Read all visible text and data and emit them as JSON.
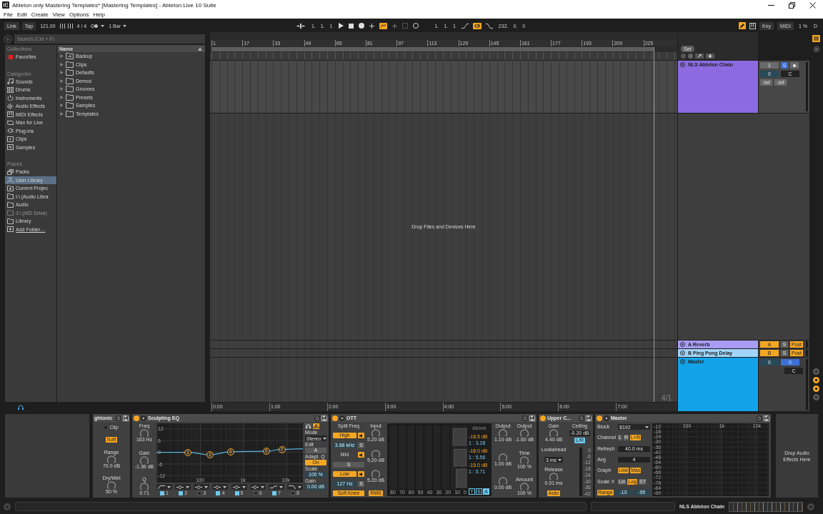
{
  "window": {
    "title": "Ableton only Mastering Templates* [Mastering Templates] - Ableton Live 10 Suite"
  },
  "menu": [
    "File",
    "Edit",
    "Create",
    "View",
    "Options",
    "Help"
  ],
  "transport": {
    "link": "Link",
    "tap": "Tap",
    "tempo": "121.00",
    "signature": "4 / 4",
    "quantization": "1 Bar",
    "position": "1. 1. 1",
    "automation_arm": true,
    "loop_start": "1. 1. 1",
    "loop": true,
    "loop_length": "232. 0. 0",
    "draw_mode": true,
    "key": "Key",
    "midi": "MIDI",
    "cpu": "1 %",
    "disk": "D"
  },
  "browser": {
    "search": {
      "placeholder": "Search (Ctrl + F)"
    },
    "sections": [
      {
        "heading": "Collections",
        "items": [
          {
            "label": "Favorites",
            "kind": "swatch",
            "color": "#e8201c",
            "selected": false,
            "disabled": false
          }
        ]
      },
      {
        "heading": "Categories",
        "items": [
          {
            "label": "Sounds",
            "kind": "note",
            "selected": false,
            "disabled": false
          },
          {
            "label": "Drums",
            "kind": "pads",
            "selected": false,
            "disabled": false
          },
          {
            "label": "Instruments",
            "kind": "power",
            "selected": false,
            "disabled": false
          },
          {
            "label": "Audio Effects",
            "kind": "wave",
            "selected": false,
            "disabled": false
          },
          {
            "label": "MIDI Effects",
            "kind": "midi",
            "selected": false,
            "disabled": false
          },
          {
            "label": "Max for Live",
            "kind": "loop",
            "selected": false,
            "disabled": false
          },
          {
            "label": "Plug-ins",
            "kind": "plug",
            "selected": false,
            "disabled": false
          },
          {
            "label": "Clips",
            "kind": "clip",
            "selected": false,
            "disabled": false
          },
          {
            "label": "Samples",
            "kind": "sample",
            "selected": false,
            "disabled": false
          }
        ]
      },
      {
        "heading": "Places",
        "items": [
          {
            "label": "Packs",
            "kind": "packs",
            "selected": false,
            "disabled": false
          },
          {
            "label": "User Library",
            "kind": "user",
            "selected": true,
            "disabled": false
          },
          {
            "label": "Current Projec",
            "kind": "project",
            "selected": false,
            "disabled": false
          },
          {
            "label": "I:\\ (Audio Libra",
            "kind": "folder",
            "selected": false,
            "disabled": false
          },
          {
            "label": "Audio",
            "kind": "folder",
            "selected": false,
            "disabled": false
          },
          {
            "label": "J:\\ (WD Drive)",
            "kind": "folder",
            "selected": false,
            "disabled": true
          },
          {
            "label": "Library",
            "kind": "folder",
            "selected": false,
            "disabled": false
          },
          {
            "label": "Add Folder…",
            "kind": "add",
            "selected": false,
            "disabled": false
          }
        ]
      }
    ],
    "column": "Name",
    "items": [
      {
        "label": "Backup",
        "kind": "backup",
        "expanded": false
      },
      {
        "label": "Clips",
        "kind": "folder",
        "expanded": false
      },
      {
        "label": "Defaults",
        "kind": "folder",
        "expanded": false
      },
      {
        "label": "Demos",
        "kind": "folder",
        "expanded": false
      },
      {
        "label": "Grooves",
        "kind": "folder",
        "expanded": false
      },
      {
        "label": "Presets",
        "kind": "folder",
        "expanded": false
      },
      {
        "label": "Samples",
        "kind": "folder",
        "expanded": false
      },
      {
        "label": "Templates",
        "kind": "folder",
        "expanded": false
      }
    ]
  },
  "arrangement": {
    "bars": [
      "1",
      "17",
      "33",
      "49",
      "65",
      "81",
      "97",
      "113",
      "129",
      "145",
      "161",
      "177",
      "193",
      "209",
      "225"
    ],
    "set": "Set",
    "tracks": [
      {
        "kind": "audio",
        "name": "NLS Ableton Chain",
        "color": "#8c6be0",
        "expanded": true,
        "activator": "1",
        "solo": "S",
        "solo_on": true,
        "volume": "0",
        "pan": "C",
        "meters": [
          "-inf",
          "-inf"
        ]
      },
      {
        "kind": "return",
        "name": "A Reverb",
        "color": "#a89cf5",
        "expanded": false,
        "send": "A",
        "solo": "S",
        "solo_on": false,
        "route": "Post"
      },
      {
        "kind": "return",
        "name": "B Ping Pong Delay",
        "color": "#a2d5f9",
        "expanded": false,
        "send": "B",
        "solo": "S",
        "solo_on": false,
        "route": "Post"
      },
      {
        "kind": "master",
        "name": "Master",
        "color": "#12a2e8",
        "expanded": true,
        "volume": "0",
        "cue": "0",
        "pan": "C"
      }
    ],
    "drop_hint": "Drop Files and Devices Here",
    "zoom": "4/1",
    "times": [
      "0:00",
      "1:00",
      "2:00",
      "3:00",
      "4:00",
      "5:00",
      "6:00",
      "7:00"
    ]
  },
  "view_toggles": [
    {
      "on": false
    },
    {
      "on": true
    },
    {
      "on": true
    },
    {
      "on": false
    }
  ],
  "devices": [
    {
      "kind": "partial",
      "name": "ghtonic",
      "columns": [
        [
          {
            "kind": "led",
            "text": "Clip",
            "on": false
          },
          {
            "kind": "toggle",
            "text": "Soft",
            "on": true
          },
          {
            "kind": "knob",
            "caption": "Range",
            "reading": "70.0 dB"
          },
          {
            "kind": "knob",
            "caption": "Dry/Wet",
            "reading": "50 %"
          }
        ]
      ]
    },
    {
      "kind": "eq",
      "name": "Sculpting EQ",
      "on": true,
      "expanded": false,
      "columns": [
        [
          {
            "kind": "knob",
            "caption": "Freq",
            "reading": "163 Hz"
          },
          {
            "kind": "knob",
            "caption": "Gain",
            "reading": "-1.36 dB"
          },
          {
            "kind": "knob",
            "caption": "Q",
            "reading": "0.71"
          }
        ],
        [
          {
            "kind": "eq_graph",
            "yticks": [
              "12",
              "6",
              "0",
              "-6",
              "-12"
            ],
            "xticks": [
              "100",
              "1k",
              "10k"
            ],
            "nodes": [
              "1",
              "2",
              "4",
              "5",
              "7"
            ]
          },
          {
            "kind": "bands",
            "items": [
              {
                "kind": "lowcut",
                "label": "1",
                "on": true
              },
              {
                "kind": "bell",
                "label": "2",
                "on": true
              },
              {
                "kind": "bell",
                "label": "3",
                "on": false
              },
              {
                "kind": "bell",
                "label": "4",
                "on": true
              },
              {
                "kind": "bell",
                "label": "5",
                "on": true
              },
              {
                "kind": "bell",
                "label": "6",
                "on": false
              },
              {
                "kind": "shelf",
                "label": "7",
                "on": true
              },
              {
                "kind": "highcut",
                "label": "8",
                "on": false
              }
            ]
          }
        ],
        [
          {
            "kind": "row",
            "items": [
              {
                "kind": "headphones_toggle",
                "on": false
              },
              {
                "kind": "spectrum_toggle",
                "on": true
              }
            ]
          },
          {
            "kind": "label",
            "text": "Mode"
          },
          {
            "kind": "dropdown",
            "text": "Stereo"
          },
          {
            "kind": "label",
            "text": "Edit"
          },
          {
            "kind": "toggle",
            "text": "A",
            "on": false
          },
          {
            "kind": "label",
            "text": "Adapt. Q"
          },
          {
            "kind": "toggle",
            "text": "On",
            "on": true
          },
          {
            "kind": "label",
            "text": "Scale"
          },
          {
            "kind": "number",
            "text": "100 %"
          },
          {
            "kind": "label",
            "text": "Gain"
          },
          {
            "kind": "number",
            "text": "0.00 dB"
          }
        ]
      ]
    },
    {
      "kind": "multiband",
      "name": "OTT",
      "on": true,
      "expanded": true,
      "columns": [
        [
          {
            "kind": "label",
            "text": "Split Freq"
          },
          {
            "kind": "row",
            "items": [
              {
                "kind": "toggle",
                "text": "High",
                "on": true
              },
              {
                "kind": "band_toggle",
                "on": true
              }
            ]
          },
          {
            "kind": "row",
            "items": [
              {
                "kind": "number",
                "text": "3.68 kHz"
              },
              {
                "kind": "toggle",
                "text": "S",
                "on": false
              }
            ]
          },
          {
            "kind": "row",
            "items": [
              {
                "kind": "label",
                "text": "Mid"
              },
              {
                "kind": "band_toggle",
                "on": true
              }
            ]
          },
          {
            "kind": "row",
            "items": [
              {
                "kind": "toggle",
                "text": "S",
                "on": false
              }
            ]
          },
          {
            "kind": "row",
            "items": [
              {
                "kind": "toggle",
                "text": "Low",
                "on": true
              },
              {
                "kind": "band_toggle",
                "on": true
              }
            ]
          },
          {
            "kind": "row",
            "items": [
              {
                "kind": "number",
                "text": "127 Hz"
              },
              {
                "kind": "toggle",
                "text": "S",
                "on": false
              }
            ]
          },
          {
            "kind": "toggle",
            "text": "Soft Knee",
            "on": true
          }
        ],
        [
          {
            "kind": "knob",
            "caption": "Input",
            "reading": "5.20 dB"
          },
          {
            "kind": "knob",
            "reading": "5.20 dB"
          },
          {
            "kind": "knob",
            "reading": "5.20 dB"
          },
          {
            "kind": "toggle",
            "text": "RMS",
            "on": true
          }
        ],
        [
          {
            "kind": "ott_display",
            "ticks": [
              "80",
              "70",
              "60",
              "50",
              "40",
              "30",
              "20",
              "10",
              "0"
            ],
            "heading": "Above",
            "bands": [
              {
                "threshold": "-18.5 dB",
                "ratio": "1 : 3.28"
              },
              {
                "threshold": "-18.0 dB",
                "ratio": "1 : 5.56"
              },
              {
                "threshold": "-15.0 dB",
                "ratio": "1 : 5.71"
              }
            ],
            "buttons": [
              {
                "text": "T",
                "on": false
              },
              {
                "text": "B",
                "on": false
              },
              {
                "text": "A",
                "on": true
              }
            ]
          }
        ],
        [
          {
            "kind": "knob",
            "caption": "Output",
            "reading": "1.10 dB"
          },
          {
            "kind": "knob",
            "reading": "1.00 dB"
          },
          {
            "kind": "knob",
            "reading": "0.00 dB"
          }
        ],
        [
          {
            "kind": "knob",
            "caption": "Output",
            "reading": "-1.60 dB"
          },
          {
            "kind": "knob",
            "caption": "Time",
            "reading": "100 %"
          },
          {
            "kind": "knob",
            "caption": "Amount",
            "reading": "100 %"
          }
        ]
      ]
    },
    {
      "kind": "limiter",
      "name": "Upper C...",
      "on": true,
      "columns": [
        [
          {
            "kind": "knob",
            "caption": "Gain",
            "reading": "4.40 dB"
          },
          {
            "kind": "label",
            "text": "Lookahead"
          },
          {
            "kind": "dropdown",
            "text": "3 ms"
          },
          {
            "kind": "knob",
            "caption": "Release",
            "reading": "0.01 ms"
          },
          {
            "kind": "toggle",
            "text": "Auto",
            "on": true
          }
        ],
        [
          {
            "kind": "label",
            "text": "Ceiling"
          },
          {
            "kind": "field",
            "text": "-0.20 dB"
          },
          {
            "kind": "mode_toggle",
            "text": "L/R",
            "on": true
          },
          {
            "kind": "meter_scale",
            "ticks": [
              "0",
              "-6",
              "-12",
              "-18",
              "-24",
              "-30",
              "-36",
              "-42"
            ]
          }
        ]
      ]
    },
    {
      "kind": "spectrum",
      "name": "Master",
      "on": true,
      "expanded": false,
      "columns": [
        [
          {
            "kind": "row",
            "items": [
              {
                "kind": "label",
                "text": "Block"
              },
              {
                "kind": "dropdown",
                "text": "8192"
              }
            ]
          },
          {
            "kind": "row",
            "items": [
              {
                "kind": "label",
                "text": "Channel"
              },
              {
                "kind": "toggle",
                "text": "L",
                "on": false
              },
              {
                "kind": "toggle",
                "text": "R",
                "on": false
              },
              {
                "kind": "toggle",
                "text": "L+R",
                "on": true
              }
            ]
          },
          {
            "kind": "row",
            "items": [
              {
                "kind": "label",
                "text": "Refresh"
              },
              {
                "kind": "field",
                "text": "40.0 ms"
              }
            ]
          },
          {
            "kind": "row",
            "items": [
              {
                "kind": "label",
                "text": "Avg"
              },
              {
                "kind": "field",
                "text": "4"
              }
            ]
          },
          {
            "kind": "row",
            "items": [
              {
                "kind": "label",
                "text": "Graph"
              },
              {
                "kind": "toggle",
                "text": "Line",
                "on": true
              },
              {
                "kind": "toggle",
                "text": "Max",
                "on": true
              }
            ]
          },
          {
            "kind": "row",
            "items": [
              {
                "kind": "label",
                "text": "Scale X"
              },
              {
                "kind": "toggle",
                "text": "Lin",
                "on": false
              },
              {
                "kind": "toggle",
                "text": "Log",
                "on": true
              },
              {
                "kind": "toggle",
                "text": "ST",
                "on": false
              }
            ]
          },
          {
            "kind": "row",
            "items": [
              {
                "kind": "toggle",
                "text": "Range",
                "on": true
              },
              {
                "kind": "number",
                "text": "-10"
              },
              {
                "kind": "number",
                "text": "-95"
              }
            ]
          }
        ],
        [
          {
            "kind": "spectrum_graph",
            "yticks": [
              "-12",
              "-18",
              "-24",
              "-30",
              "-36",
              "-42",
              "-48",
              "-54",
              "-60",
              "-66",
              "-72",
              "-78",
              "-84",
              "-90"
            ],
            "xticks": [
              "100",
              "1k",
              "10k"
            ]
          }
        ]
      ]
    }
  ],
  "drop_effects": "Drop Audio Effects Here",
  "status_bar": {
    "track": "NLS Ableton Chain"
  }
}
